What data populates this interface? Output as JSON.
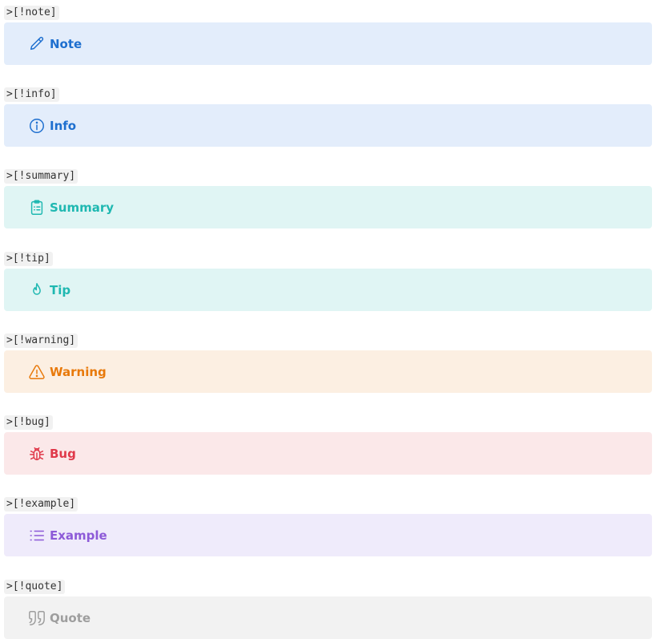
{
  "callouts": [
    {
      "code": ">[!note]",
      "title": "Note",
      "icon": "pencil-icon",
      "color": "#1e6fcf",
      "bg": "#e3edfb"
    },
    {
      "code": ">[!info]",
      "title": "Info",
      "icon": "info-icon",
      "color": "#1e6fcf",
      "bg": "#e3edfb"
    },
    {
      "code": ">[!summary]",
      "title": "Summary",
      "icon": "clipboard-list-icon",
      "color": "#1fb8b1",
      "bg": "#e0f5f4"
    },
    {
      "code": ">[!tip]",
      "title": "Tip",
      "icon": "flame-icon",
      "color": "#1fb8b1",
      "bg": "#e0f5f4"
    },
    {
      "code": ">[!warning]",
      "title": "Warning",
      "icon": "warning-triangle-icon",
      "color": "#e8790a",
      "bg": "#fcefe2"
    },
    {
      "code": ">[!bug]",
      "title": "Bug",
      "icon": "bug-icon",
      "color": "#e0394a",
      "bg": "#fbe8e9"
    },
    {
      "code": ">[!example]",
      "title": "Example",
      "icon": "list-icon",
      "color": "#8d5ad8",
      "bg": "#efebfb"
    },
    {
      "code": ">[!quote]",
      "title": "Quote",
      "icon": "quote-icon",
      "color": "#9e9e9e",
      "bg": "#f2f2f2"
    }
  ]
}
